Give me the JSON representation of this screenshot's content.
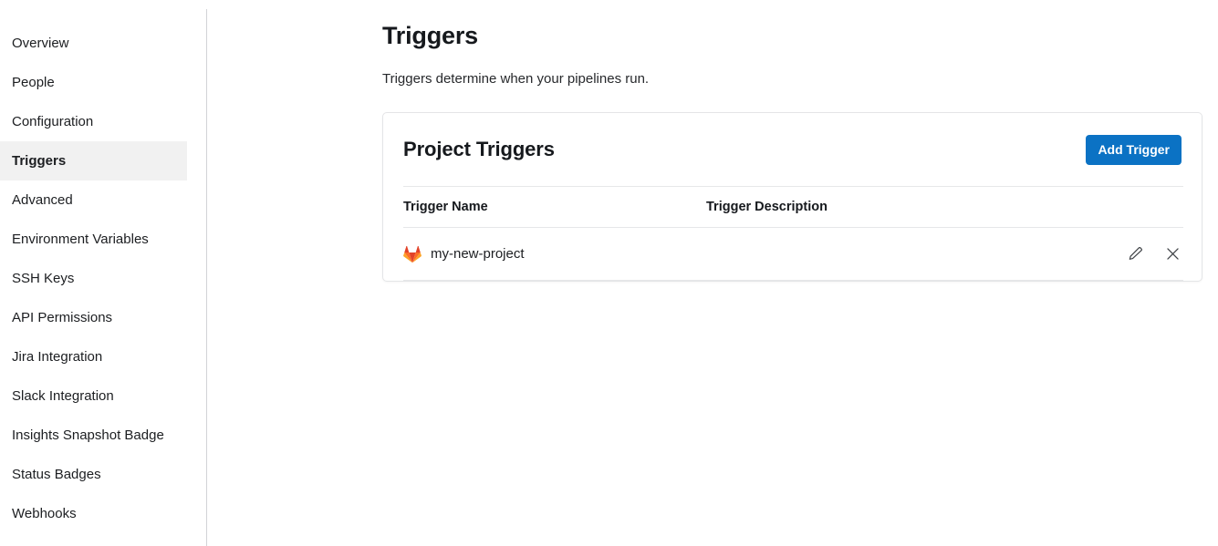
{
  "sidebar": {
    "items": [
      {
        "label": "Overview",
        "active": false
      },
      {
        "label": "People",
        "active": false
      },
      {
        "label": "Configuration",
        "active": false
      },
      {
        "label": "Triggers",
        "active": true
      },
      {
        "label": "Advanced",
        "active": false
      },
      {
        "label": "Environment Variables",
        "active": false
      },
      {
        "label": "SSH Keys",
        "active": false
      },
      {
        "label": "API Permissions",
        "active": false
      },
      {
        "label": "Jira Integration",
        "active": false
      },
      {
        "label": "Slack Integration",
        "active": false
      },
      {
        "label": "Insights Snapshot Badge",
        "active": false
      },
      {
        "label": "Status Badges",
        "active": false
      },
      {
        "label": "Webhooks",
        "active": false
      }
    ]
  },
  "page": {
    "title": "Triggers",
    "subtitle": "Triggers determine when your pipelines run."
  },
  "card": {
    "title": "Project Triggers",
    "add_button_label": "Add Trigger",
    "accent_color": "#0b72c4",
    "table": {
      "columns": [
        "Trigger Name",
        "Trigger Description",
        ""
      ],
      "rows": [
        {
          "icon": "gitlab-logo-icon",
          "name": "my-new-project",
          "description": "",
          "actions": [
            "edit-icon",
            "delete-icon"
          ]
        }
      ]
    }
  },
  "icons": {
    "edit": "pencil-icon",
    "delete": "close-x-icon"
  }
}
